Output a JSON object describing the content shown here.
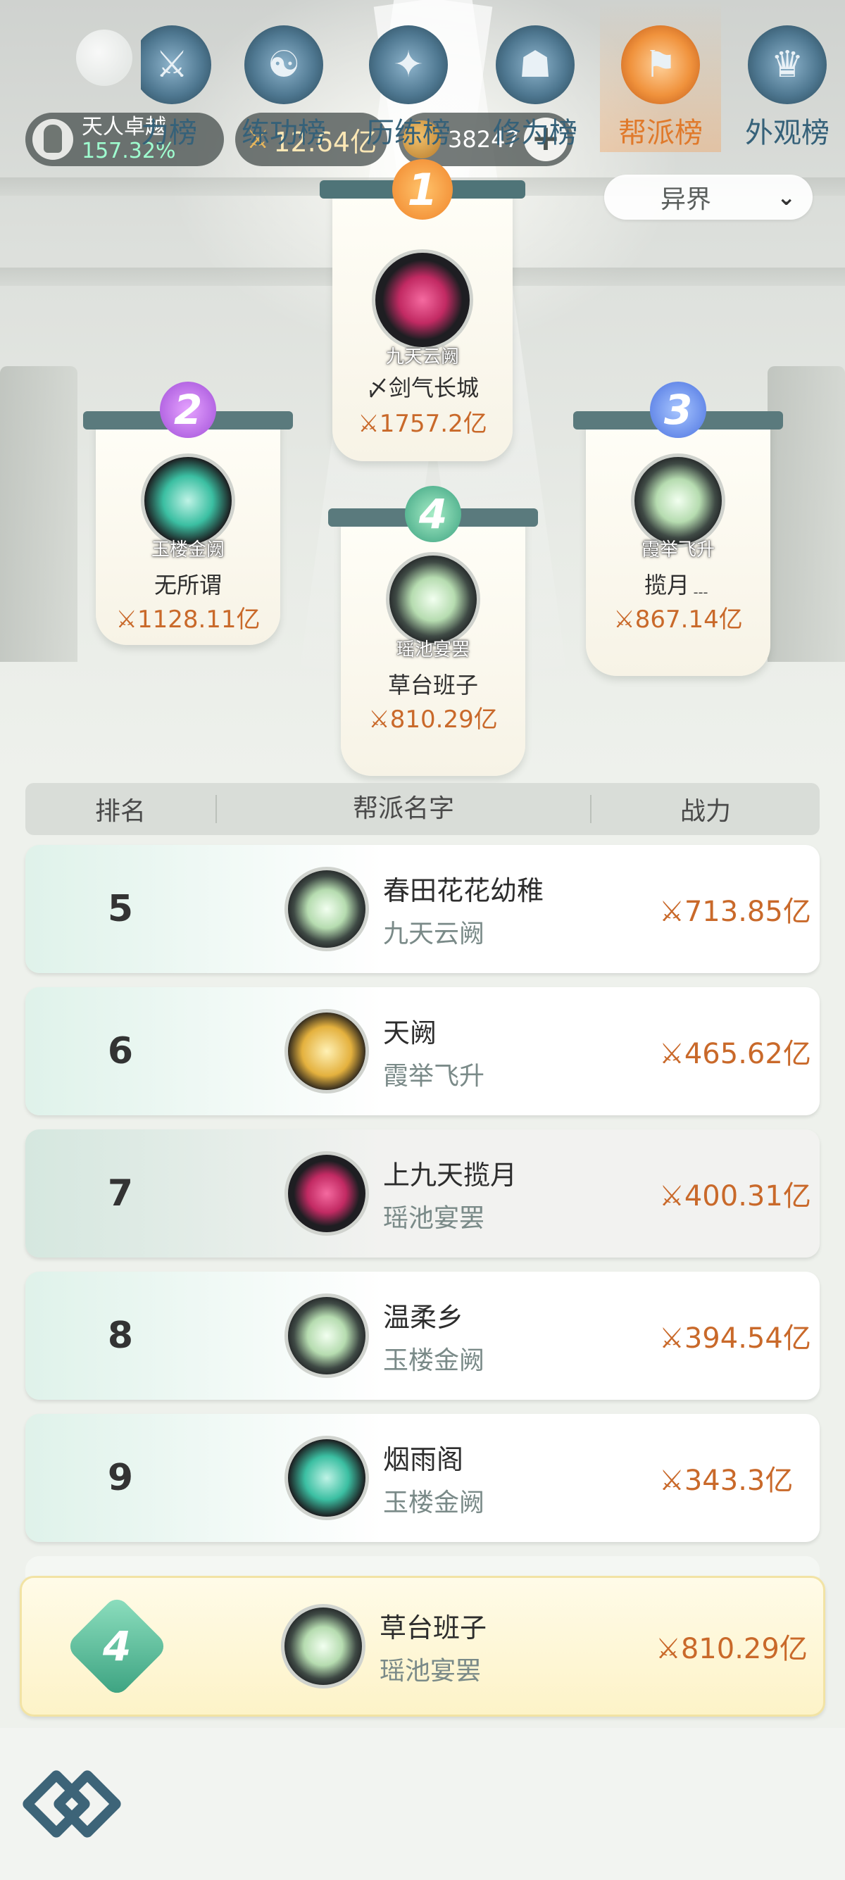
{
  "header": {
    "realm_title": "天人卓越",
    "realm_percent": "157.32%",
    "power_value": "12.64亿",
    "coin_value": "38247",
    "plus_label": "+"
  },
  "filter": {
    "selected": "异界",
    "chevron": "⌄"
  },
  "podium": [
    {
      "rank": "1",
      "emblem": "flame-emblem",
      "guild": "九天云阙",
      "leader": "〆剑气长城",
      "power": "1757.2亿"
    },
    {
      "rank": "2",
      "emblem": "serpent-emblem",
      "guild": "玉楼金阙",
      "leader": "无所谓",
      "power": "1128.11亿"
    },
    {
      "rank": "3",
      "emblem": "leaf-emblem",
      "guild": "霞举飞升",
      "leader": "揽月﹍",
      "power": "867.14亿"
    },
    {
      "rank": "4",
      "emblem": "leaf-emblem",
      "guild": "瑶池宴罢",
      "leader": "草台班子",
      "power": "810.29亿"
    }
  ],
  "table": {
    "headers": {
      "rank": "排名",
      "name": "帮派名字",
      "power": "战力"
    },
    "rows": [
      {
        "rank": "5",
        "emblem": "leaf-emblem",
        "name": "春田花花幼稚",
        "server": "九天云阙",
        "power": "713.85亿"
      },
      {
        "rank": "6",
        "emblem": "pagoda-emblem",
        "name": "天阙",
        "server": "霞举飞升",
        "power": "465.62亿"
      },
      {
        "rank": "7",
        "emblem": "flame-emblem",
        "name": "上九天揽月",
        "server": "瑶池宴罢",
        "power": "400.31亿"
      },
      {
        "rank": "8",
        "emblem": "leaf-emblem",
        "name": "温柔乡",
        "server": "玉楼金阙",
        "power": "394.54亿"
      },
      {
        "rank": "9",
        "emblem": "serpent-emblem",
        "name": "烟雨阁",
        "server": "玉楼金阙",
        "power": "343.3亿"
      }
    ],
    "mine": {
      "rank": "4",
      "emblem": "leaf-emblem",
      "name": "草台班子",
      "server": "瑶池宴罢",
      "power": "810.29亿"
    }
  },
  "nav": {
    "items": [
      {
        "label": "力榜",
        "icon": "power-icon"
      },
      {
        "label": "练功榜",
        "icon": "taiji-icon"
      },
      {
        "label": "历练榜",
        "icon": "compass-icon"
      },
      {
        "label": "修为榜",
        "icon": "hat-icon"
      },
      {
        "label": "帮派榜",
        "icon": "banner-icon",
        "active": true
      },
      {
        "label": "外观榜",
        "icon": "robe-icon"
      }
    ]
  },
  "colors": {
    "accent": "#c9692a",
    "nav": "#356179",
    "active_nav": "#e07a2c"
  }
}
